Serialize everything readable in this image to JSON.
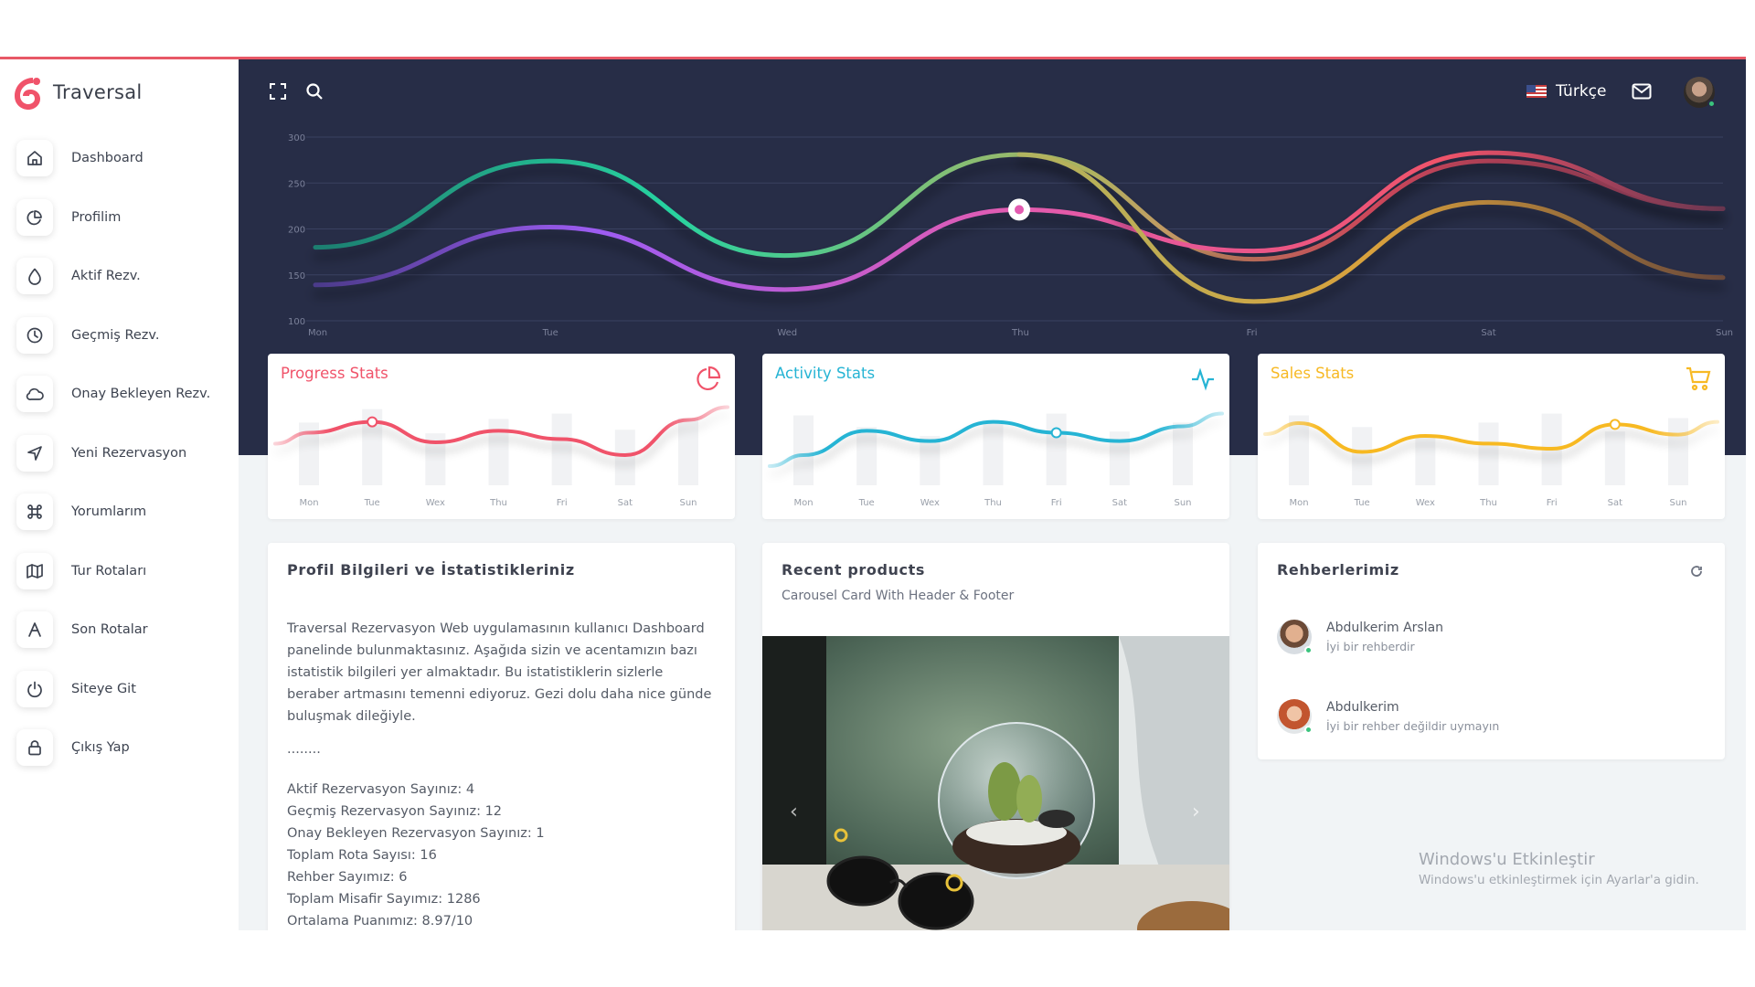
{
  "app": {
    "name": "Traversal"
  },
  "sidebar": {
    "items": [
      {
        "label": "Dashboard",
        "icon": "home-icon"
      },
      {
        "label": "Profilim",
        "icon": "pie-chart-icon"
      },
      {
        "label": "Aktif Rezv.",
        "icon": "droplet-icon"
      },
      {
        "label": "Geçmiş Rezv.",
        "icon": "clock-icon"
      },
      {
        "label": "Onay Bekleyen Rezv.",
        "icon": "cloud-icon"
      },
      {
        "label": "Yeni Rezervasyon",
        "icon": "navigation-icon"
      },
      {
        "label": "Yorumlarım",
        "icon": "command-icon"
      },
      {
        "label": "Tur Rotaları",
        "icon": "map-icon"
      },
      {
        "label": "Son Rotalar",
        "icon": "triangle-a-icon"
      },
      {
        "label": "Siteye Git",
        "icon": "power-icon"
      },
      {
        "label": "Çıkış Yap",
        "icon": "lock-icon"
      }
    ]
  },
  "header": {
    "language": "Türkçe",
    "icons": [
      "fullscreen-icon",
      "search-icon",
      "flag-icon",
      "mail-icon",
      "avatar"
    ]
  },
  "colors": {
    "hero_bg": "#272d47",
    "accent": "#e85866",
    "progress": "#f0536a",
    "activity": "#26b4d4",
    "sales": "#f7b924",
    "online": "#3ac47d"
  },
  "chart_data": [
    {
      "type": "line",
      "x": [
        "Mon",
        "Tue",
        "Wed",
        "Thu",
        "Fri",
        "Sat",
        "Sun"
      ],
      "yticks": [
        100,
        150,
        200,
        250,
        300
      ],
      "ylim": [
        100,
        300
      ],
      "grid": true,
      "highlight": {
        "x": "Thu",
        "y": 221
      },
      "series": [
        {
          "values": [
            180,
            274,
            171,
            281,
            167,
            274,
            222
          ],
          "color": "#27d3a0"
        },
        {
          "values": [
            139,
            202,
            134,
            221,
            176,
            283,
            222
          ],
          "color": "#9d5cf2"
        },
        {
          "values": [
            null,
            null,
            null,
            281,
            121,
            229,
            147
          ],
          "color": "#d9a13c"
        }
      ]
    },
    {
      "type": "line",
      "title": "Progress Stats",
      "x": [
        "Mon",
        "Tue",
        "Wex",
        "Thu",
        "Fri",
        "Sat",
        "Sun"
      ],
      "values": [
        45,
        62,
        30,
        48,
        35,
        10,
        65
      ],
      "bars": [
        70,
        85,
        58,
        74,
        80,
        62,
        75
      ],
      "highlight_index": 1,
      "color": "#f0536a"
    },
    {
      "type": "line",
      "title": "Activity Stats",
      "x": [
        "Mon",
        "Tue",
        "Wex",
        "Thu",
        "Fri",
        "Sat",
        "Sun"
      ],
      "values": [
        10,
        48,
        32,
        62,
        45,
        32,
        55
      ],
      "bars": [
        78,
        65,
        55,
        72,
        80,
        60,
        70
      ],
      "highlight_index": 4,
      "color": "#26b4d4"
    },
    {
      "type": "line",
      "title": "Sales Stats",
      "x": [
        "Mon",
        "Tue",
        "Wex",
        "Thu",
        "Fri",
        "Sat",
        "Sun"
      ],
      "values": [
        60,
        15,
        40,
        28,
        20,
        58,
        42
      ],
      "bars": [
        78,
        65,
        55,
        70,
        80,
        60,
        75
      ],
      "highlight_index": 5,
      "color": "#f7b924"
    }
  ],
  "profile": {
    "title": "Profil Bilgileri ve İstatistikleriniz",
    "paragraph": "Traversal Rezervasyon Web uygulamasının kullanıcı Dashboard panelinde bulunmaktasınız. Aşağıda sizin ve acentamızın bazı istatistik bilgileri yer almaktadır. Bu istatistiklerin sizlerle beraber artmasını temenni ediyoruz. Gezi dolu daha nice günde buluşmak dileğiyle.",
    "dots": "........",
    "stats": [
      "Aktif Rezervasyon Sayınız: 4",
      "Geçmiş Rezervasyon Sayınız: 12",
      "Onay Bekleyen Rezervasyon Sayınız: 1",
      "Toplam Rota Sayısı: 16",
      "Rehber Sayımız: 6",
      "Toplam Misafir Sayımız: 1286",
      "Ortalama Puanımız: 8.97/10"
    ]
  },
  "products": {
    "title": "Recent products",
    "subtitle": "Carousel Card With Header & Footer"
  },
  "guides": {
    "title": "Rehberlerimiz",
    "items": [
      {
        "name": "Abdulkerim Arslan",
        "desc": "İyi bir rehberdir"
      },
      {
        "name": "Abdulkerim",
        "desc": "İyi bir rehber değildir uymayın"
      }
    ]
  },
  "watermark": {
    "title": "Windows'u Etkinleştir",
    "subtitle": "Windows'u etkinleştirmek için Ayarlar'a gidin."
  }
}
